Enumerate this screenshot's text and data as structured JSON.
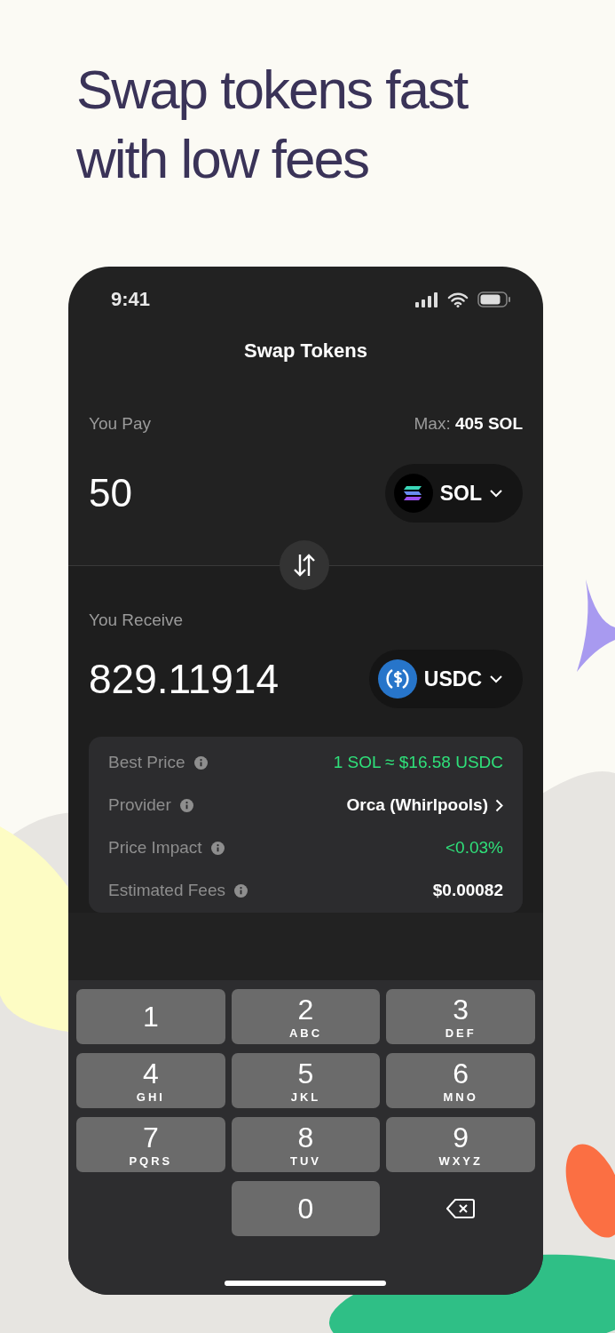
{
  "headline_lines": [
    "Swap tokens fast",
    "with low fees"
  ],
  "status_bar": {
    "time": "9:41"
  },
  "title": "Swap Tokens",
  "pay": {
    "label": "You Pay",
    "max_label": "Max:",
    "max_value": "405 SOL",
    "amount": "50",
    "token": "SOL",
    "kind": "sol"
  },
  "receive": {
    "label": "You Receive",
    "amount": "829.11914",
    "token": "USDC",
    "kind": "usdc"
  },
  "details": [
    {
      "label": "Best Price",
      "value": "1 SOL ≈ $16.58 USDC",
      "kind": "positive"
    },
    {
      "label": "Provider",
      "value": "Orca (Whirlpools)",
      "kind": "link"
    },
    {
      "label": "Price Impact",
      "value": "<0.03%",
      "kind": "positive"
    },
    {
      "label": "Estimated Fees",
      "value": "$0.00082",
      "kind": "plain"
    }
  ],
  "keypad": [
    {
      "kind": "digit",
      "digit": "1"
    },
    {
      "kind": "digit",
      "digit": "2",
      "letters": "ABC"
    },
    {
      "kind": "digit",
      "digit": "3",
      "letters": "DEF"
    },
    {
      "kind": "digit",
      "digit": "4",
      "letters": "GHI"
    },
    {
      "kind": "digit",
      "digit": "5",
      "letters": "JKL"
    },
    {
      "kind": "digit",
      "digit": "6",
      "letters": "MNO"
    },
    {
      "kind": "digit",
      "digit": "7",
      "letters": "PQRS"
    },
    {
      "kind": "digit",
      "digit": "8",
      "letters": "TUV"
    },
    {
      "kind": "digit",
      "digit": "9",
      "letters": "WXYZ"
    },
    {
      "kind": "blank"
    },
    {
      "kind": "digit",
      "digit": "0"
    },
    {
      "kind": "backspace"
    }
  ]
}
